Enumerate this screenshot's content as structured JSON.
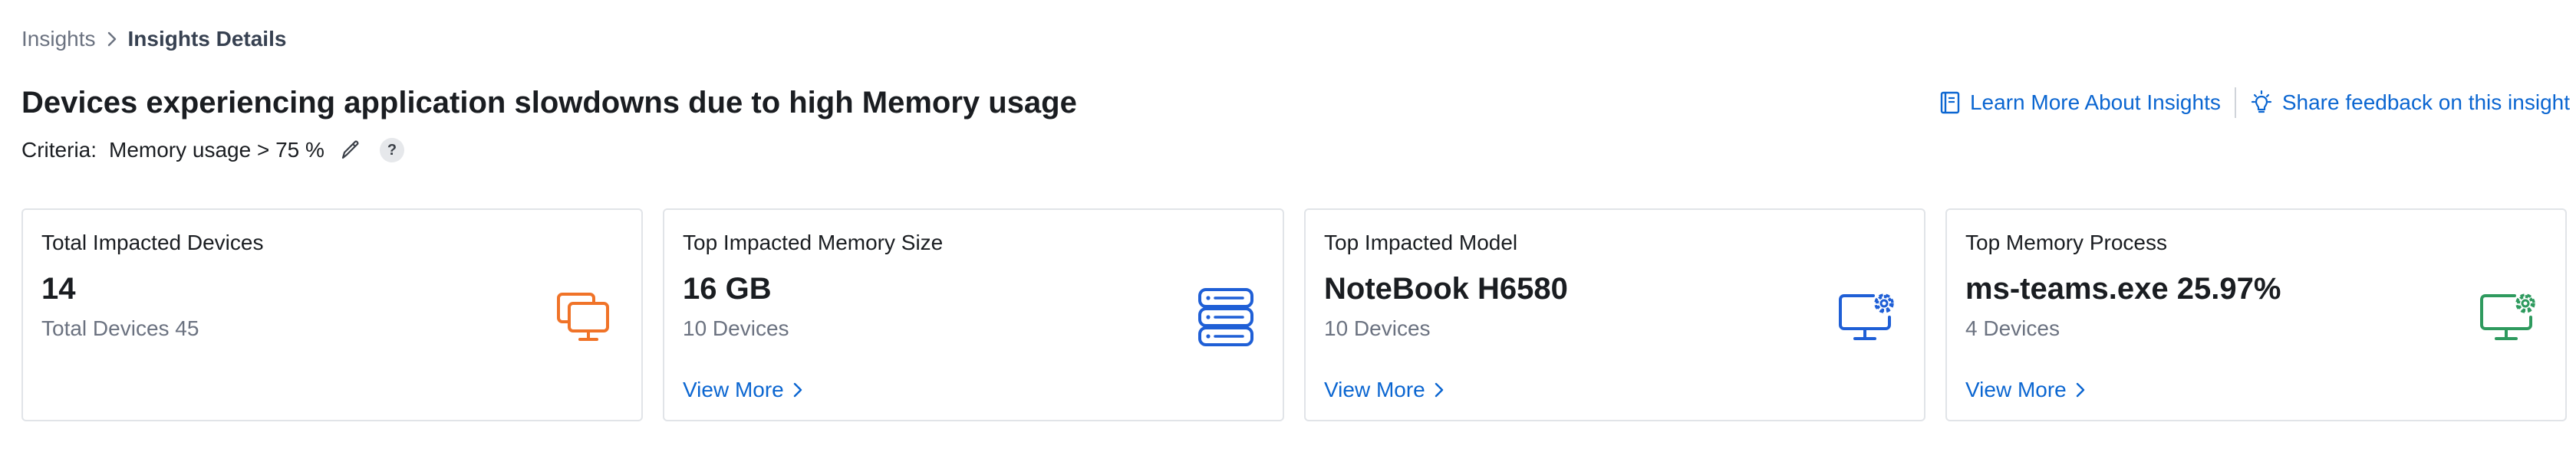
{
  "breadcrumb": {
    "parent": "Insights",
    "current": "Insights Details"
  },
  "title": "Devices experiencing application slowdowns due to high Memory usage",
  "header_links": {
    "learn_more": "Learn More About Insights",
    "feedback": "Share feedback on this insight"
  },
  "criteria": {
    "label": "Criteria:",
    "value": "Memory usage > 75 %",
    "help": "?"
  },
  "cards": [
    {
      "label": "Total Impacted Devices",
      "value": "14",
      "sub": "Total Devices 45",
      "icon": "devices-icon",
      "icon_color": "#f07328"
    },
    {
      "label": "Top Impacted Memory Size",
      "value": "16 GB",
      "sub": "10 Devices",
      "link": "View More",
      "icon": "server-stack-icon",
      "icon_color": "#1f5fd6"
    },
    {
      "label": "Top Impacted Model",
      "value": "NoteBook H6580",
      "sub": "10 Devices",
      "link": "View More",
      "icon": "monitor-gear-icon",
      "icon_color": "#1f5fd6"
    },
    {
      "label": "Top Memory Process",
      "value": "ms-teams.exe 25.97%",
      "sub": "4 Devices",
      "link": "View More",
      "icon": "monitor-gear-icon",
      "icon_color": "#2e9a5e"
    }
  ],
  "colors": {
    "link": "#0b66d1",
    "border": "#e1e4e8",
    "muted_text": "#6b7280"
  }
}
